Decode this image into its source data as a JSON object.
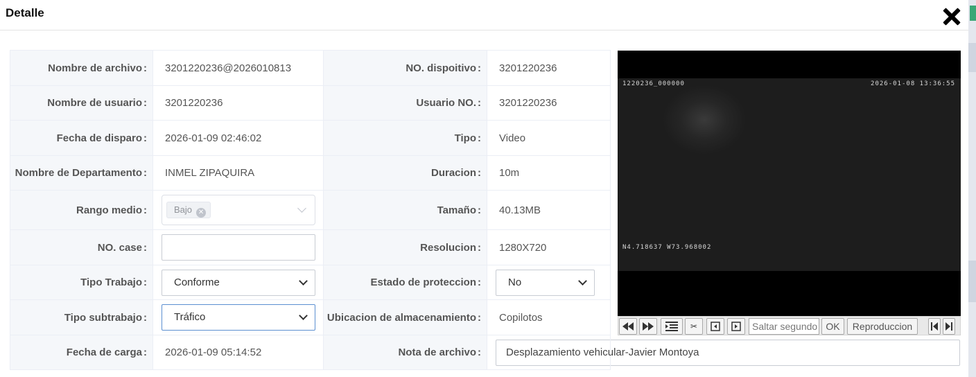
{
  "dialog": {
    "title": "Detalle"
  },
  "form": {
    "file_name": {
      "label": "Nombre de archivo",
      "value": "3201220236@2026010813"
    },
    "device_no": {
      "label": "NO. dispoitivo",
      "value": "3201220236"
    },
    "user_name": {
      "label": "Nombre de usuario",
      "value": "3201220236"
    },
    "user_no": {
      "label": "Usuario NO.",
      "value": "3201220236"
    },
    "trigger_date": {
      "label": "Fecha de disparo",
      "value": "2026-01-09 02:46:02"
    },
    "type": {
      "label": "Tipo",
      "value": "Video"
    },
    "department": {
      "label": "Nombre de Departamento",
      "value": "INMEL ZIPAQUIRA"
    },
    "duration": {
      "label": "Duracion",
      "value": "10m"
    },
    "range": {
      "label": "Rango medio",
      "tag": "Bajo"
    },
    "size": {
      "label": "Tamaño",
      "value": "40.13MB"
    },
    "case_no": {
      "label": "NO. case",
      "value": ""
    },
    "resolution": {
      "label": "Resolucion",
      "value": "1280X720"
    },
    "work_type": {
      "label": "Tipo Trabajo",
      "value": "Conforme"
    },
    "protection": {
      "label": "Estado de proteccion",
      "value": "No"
    },
    "subwork_type": {
      "label": "Tipo subtrabajo",
      "value": "Tráfico"
    },
    "storage": {
      "label": "Ubicacion de almacenamiento",
      "value": "Copilotos"
    },
    "upload_date": {
      "label": "Fecha de carga",
      "value": "2026-01-09 05:14:52"
    },
    "file_note": {
      "label": "Nota de archivo",
      "value": "Desplazamiento vehicular-Javier Montoya"
    }
  },
  "video": {
    "osd_channel": "1220236_000000",
    "osd_datetime": "2026-01-08 13:36:55",
    "osd_gps": "N4.718637 W73.968002"
  },
  "player": {
    "seek_placeholder": "Saltar segundo",
    "ok_label": "OK",
    "playback_label": "Reproduccion",
    "icons": [
      "rewind-icon",
      "fast-forward-icon",
      "list-icon",
      "scissors-icon",
      "prev-frame-icon",
      "next-frame-icon",
      "skip-start-icon",
      "skip-end-icon"
    ]
  }
}
